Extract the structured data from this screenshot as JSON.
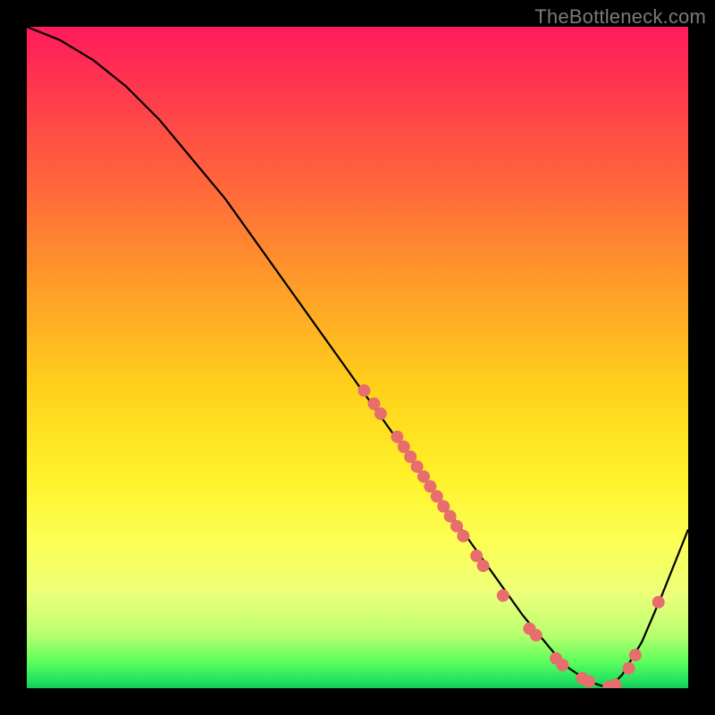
{
  "watermark": "TheBottleneck.com",
  "chart_data": {
    "type": "line",
    "title": "",
    "xlabel": "",
    "ylabel": "",
    "xlim": [
      0,
      100
    ],
    "ylim": [
      0,
      100
    ],
    "background_gradient": {
      "top": "#ff1a5c",
      "mid_upper": "#ffa028",
      "mid": "#fff22a",
      "mid_lower": "#b8ff70",
      "bottom": "#18c858"
    },
    "series": [
      {
        "name": "bottleneck-curve",
        "x": [
          0,
          5,
          10,
          15,
          20,
          25,
          30,
          35,
          40,
          45,
          50,
          55,
          60,
          65,
          70,
          75,
          80,
          82,
          85,
          88,
          90,
          93,
          96,
          100
        ],
        "y": [
          100,
          98,
          95,
          91,
          86,
          80,
          74,
          67,
          60,
          53,
          46,
          39,
          32,
          25,
          18,
          11,
          5,
          3,
          1,
          0,
          2,
          7,
          14,
          24
        ]
      }
    ],
    "points": [
      {
        "x": 51,
        "y": 45
      },
      {
        "x": 52.5,
        "y": 43
      },
      {
        "x": 53.5,
        "y": 41.5
      },
      {
        "x": 56,
        "y": 38
      },
      {
        "x": 57,
        "y": 36.5
      },
      {
        "x": 58,
        "y": 35
      },
      {
        "x": 59,
        "y": 33.5
      },
      {
        "x": 60,
        "y": 32
      },
      {
        "x": 61,
        "y": 30.5
      },
      {
        "x": 62,
        "y": 29
      },
      {
        "x": 63,
        "y": 27.5
      },
      {
        "x": 64,
        "y": 26
      },
      {
        "x": 65,
        "y": 24.5
      },
      {
        "x": 66,
        "y": 23
      },
      {
        "x": 68,
        "y": 20
      },
      {
        "x": 69,
        "y": 18.5
      },
      {
        "x": 72,
        "y": 14
      },
      {
        "x": 76,
        "y": 9
      },
      {
        "x": 77,
        "y": 8
      },
      {
        "x": 80,
        "y": 4.5
      },
      {
        "x": 81,
        "y": 3.5
      },
      {
        "x": 84,
        "y": 1.5
      },
      {
        "x": 85,
        "y": 1
      },
      {
        "x": 88,
        "y": 0.2
      },
      {
        "x": 89,
        "y": 0.5
      },
      {
        "x": 91,
        "y": 3
      },
      {
        "x": 92,
        "y": 5
      },
      {
        "x": 95.5,
        "y": 13
      }
    ]
  }
}
